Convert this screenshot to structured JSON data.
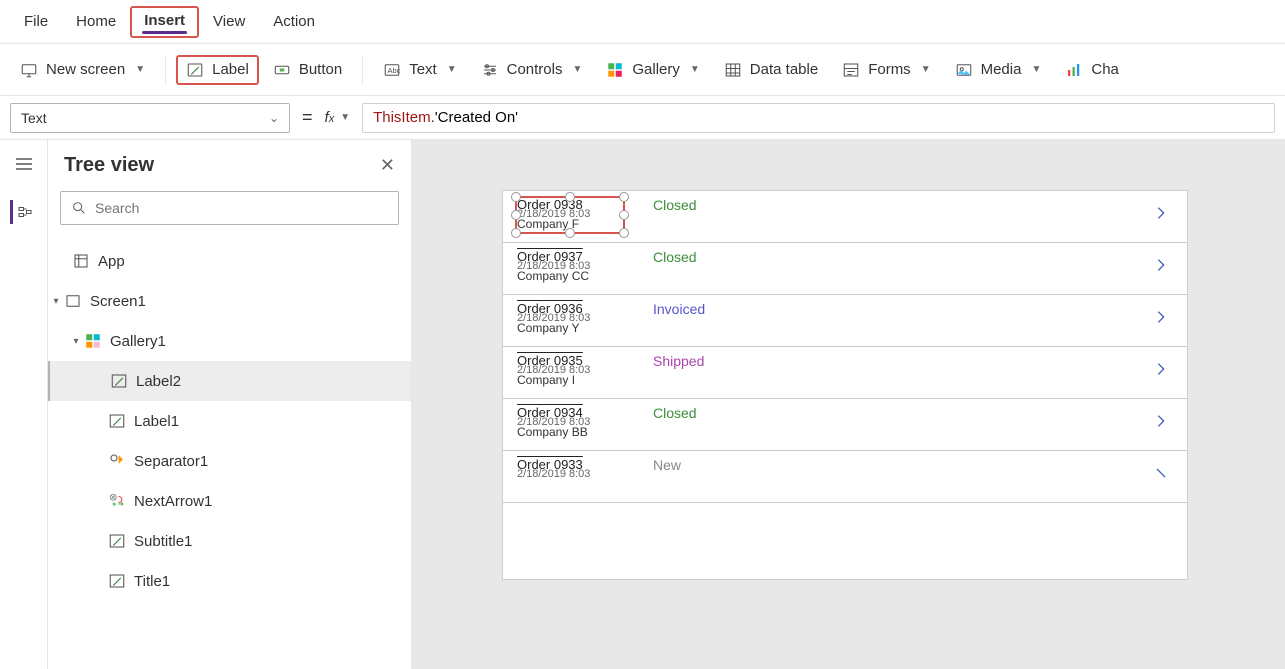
{
  "menubar": {
    "file": "File",
    "home": "Home",
    "insert": "Insert",
    "view": "View",
    "action": "Action"
  },
  "ribbon": {
    "new_screen": "New screen",
    "label": "Label",
    "button": "Button",
    "text": "Text",
    "controls": "Controls",
    "gallery": "Gallery",
    "data_table": "Data table",
    "forms": "Forms",
    "media": "Media",
    "charts": "Cha"
  },
  "formula": {
    "property": "Text",
    "token_this": "ThisItem",
    "token_dot": ".",
    "token_field": "'Created On'"
  },
  "tree": {
    "title": "Tree view",
    "search_placeholder": "Search",
    "nodes": {
      "app": "App",
      "screen1": "Screen1",
      "gallery1": "Gallery1",
      "label2": "Label2",
      "label1": "Label1",
      "separator1": "Separator1",
      "nextarrow1": "NextArrow1",
      "subtitle1": "Subtitle1",
      "title1": "Title1"
    }
  },
  "gallery": {
    "rows": [
      {
        "title": "Order 0938",
        "date": "2/18/2019 8:03",
        "company": "Company F",
        "status": "Closed",
        "status_class": "closed"
      },
      {
        "title": "Order 0937",
        "date": "2/18/2019 8:03",
        "company": "Company CC",
        "status": "Closed",
        "status_class": "closed"
      },
      {
        "title": "Order 0936",
        "date": "2/18/2019 8:03",
        "company": "Company Y",
        "status": "Invoiced",
        "status_class": "invoiced"
      },
      {
        "title": "Order 0935",
        "date": "2/18/2019 8:03",
        "company": "Company I",
        "status": "Shipped",
        "status_class": "shipped"
      },
      {
        "title": "Order 0934",
        "date": "2/18/2019 8:03",
        "company": "Company BB",
        "status": "Closed",
        "status_class": "closed"
      },
      {
        "title": "Order 0933",
        "date": "2/18/2019 8:03",
        "company": "",
        "status": "New",
        "status_class": "new"
      }
    ]
  }
}
